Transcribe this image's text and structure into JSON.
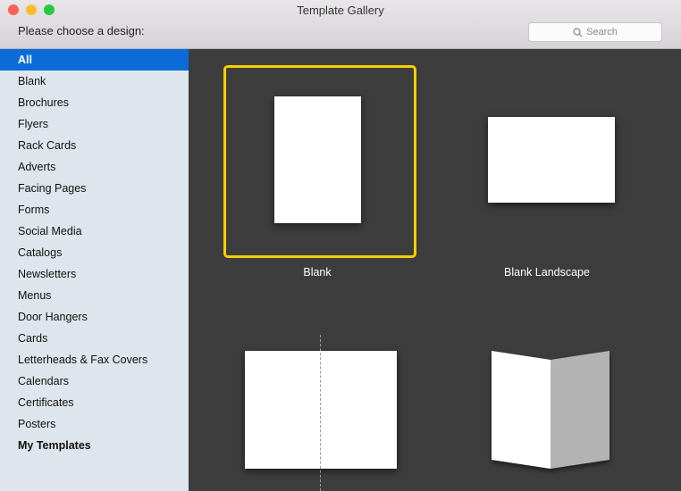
{
  "window": {
    "title": "Template Gallery",
    "prompt": "Please choose a design:",
    "search_placeholder": "Search",
    "traffic_colors": [
      "#fe5f57",
      "#febc2e",
      "#28c840"
    ]
  },
  "sidebar": {
    "items": [
      {
        "label": "All",
        "selected": true
      },
      {
        "label": "Blank"
      },
      {
        "label": "Brochures"
      },
      {
        "label": "Flyers"
      },
      {
        "label": "Rack Cards"
      },
      {
        "label": "Adverts"
      },
      {
        "label": "Facing Pages"
      },
      {
        "label": "Forms"
      },
      {
        "label": "Social Media"
      },
      {
        "label": "Catalogs"
      },
      {
        "label": "Newsletters"
      },
      {
        "label": "Menus"
      },
      {
        "label": "Door Hangers"
      },
      {
        "label": "Cards"
      },
      {
        "label": "Letterheads & Fax Covers"
      },
      {
        "label": "Calendars"
      },
      {
        "label": "Certificates"
      },
      {
        "label": "Posters"
      },
      {
        "label": "My Templates",
        "bold": true
      }
    ]
  },
  "gallery": {
    "templates": [
      {
        "label": "Blank",
        "selected": true
      },
      {
        "label": "Blank Landscape"
      }
    ],
    "accent": "#f5d000"
  }
}
